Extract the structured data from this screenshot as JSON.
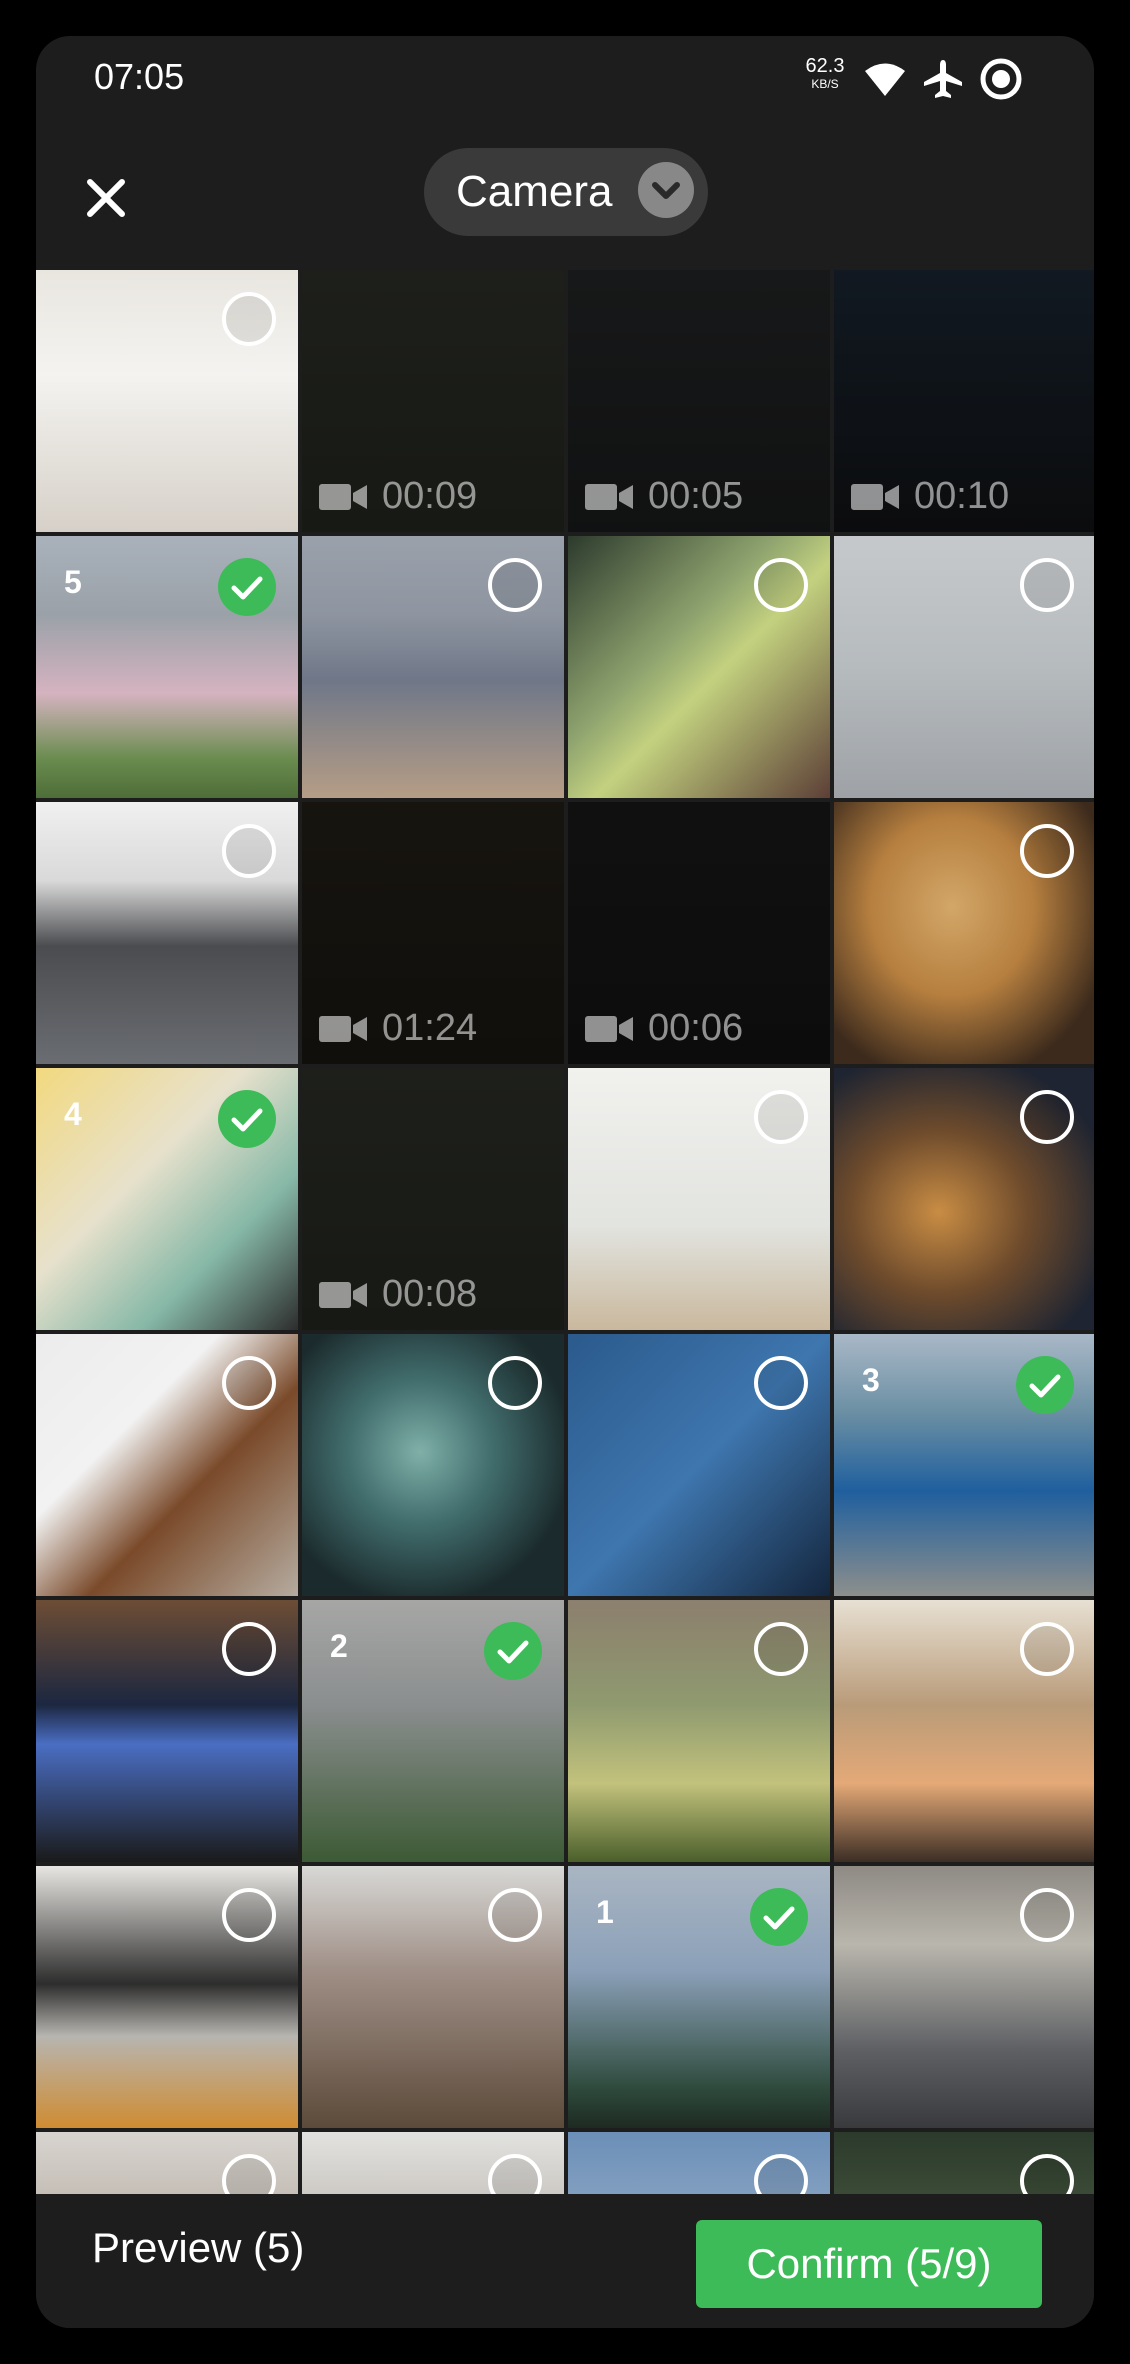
{
  "status_bar": {
    "time": "07:05",
    "net_value": "62.3",
    "net_unit": "KB/S"
  },
  "header": {
    "album": "Camera"
  },
  "grid": [
    {
      "type": "photo"
    },
    {
      "type": "video",
      "duration": "00:09"
    },
    {
      "type": "video",
      "duration": "00:05"
    },
    {
      "type": "video",
      "duration": "00:10"
    },
    {
      "type": "photo",
      "selected": true,
      "order": "5"
    },
    {
      "type": "photo"
    },
    {
      "type": "photo"
    },
    {
      "type": "photo"
    },
    {
      "type": "photo"
    },
    {
      "type": "video",
      "duration": "01:24"
    },
    {
      "type": "video",
      "duration": "00:06"
    },
    {
      "type": "photo"
    },
    {
      "type": "photo",
      "selected": true,
      "order": "4"
    },
    {
      "type": "video",
      "duration": "00:08"
    },
    {
      "type": "photo"
    },
    {
      "type": "photo"
    },
    {
      "type": "photo"
    },
    {
      "type": "photo"
    },
    {
      "type": "photo"
    },
    {
      "type": "photo",
      "selected": true,
      "order": "3"
    },
    {
      "type": "photo"
    },
    {
      "type": "photo",
      "selected": true,
      "order": "2"
    },
    {
      "type": "photo"
    },
    {
      "type": "photo"
    },
    {
      "type": "photo"
    },
    {
      "type": "photo"
    },
    {
      "type": "photo",
      "selected": true,
      "order": "1"
    },
    {
      "type": "photo"
    },
    {
      "type": "photo"
    },
    {
      "type": "photo"
    },
    {
      "type": "photo"
    },
    {
      "type": "photo"
    }
  ],
  "bottom_bar": {
    "preview_label": "Preview (5)",
    "confirm_label": "Confirm (5/9)"
  },
  "colors": {
    "accent": "#3dbb58",
    "background": "#1d1d1d"
  }
}
